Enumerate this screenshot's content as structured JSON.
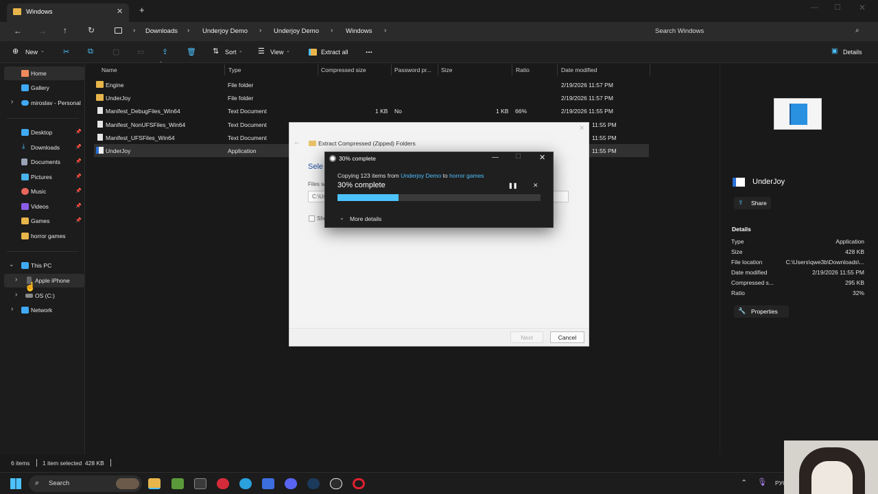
{
  "window": {
    "tab_title": "Windows",
    "new_tab_icon": "plus-icon",
    "controls": [
      "minimize-icon",
      "maximize-icon",
      "close-icon"
    ]
  },
  "address": {
    "crumbs": [
      "Downloads",
      "Underjoy Demo",
      "Underjoy Demo",
      "Windows"
    ],
    "search_placeholder": "Search Windows"
  },
  "toolbar": {
    "new_label": "New",
    "sort_label": "Sort",
    "view_label": "View",
    "extract_label": "Extract all",
    "more_label": "...",
    "details_label": "Details"
  },
  "sidebar": {
    "items": [
      {
        "label": "Home",
        "icon": "home-icon"
      },
      {
        "label": "Gallery",
        "icon": "gallery-icon"
      },
      {
        "label": "miroslav - Personal",
        "icon": "cloud-icon"
      },
      {
        "label": "Desktop",
        "icon": "desktop-icon"
      },
      {
        "label": "Downloads",
        "icon": "download-icon"
      },
      {
        "label": "Documents",
        "icon": "documents-icon"
      },
      {
        "label": "Pictures",
        "icon": "pictures-icon"
      },
      {
        "label": "Music",
        "icon": "music-icon"
      },
      {
        "label": "Videos",
        "icon": "videos-icon"
      },
      {
        "label": "Games",
        "icon": "folder-icon"
      },
      {
        "label": "horror games",
        "icon": "folder-icon"
      },
      {
        "label": "This PC",
        "icon": "pc-icon"
      },
      {
        "label": "Apple iPhone",
        "icon": "phone-icon"
      },
      {
        "label": "OS (C:)",
        "icon": "drive-icon"
      },
      {
        "label": "Network",
        "icon": "network-icon"
      }
    ]
  },
  "table": {
    "columns": [
      "Name",
      "Type",
      "Compressed size",
      "Password pr...",
      "Size",
      "Ratio",
      "Date modified"
    ],
    "rows": [
      {
        "name": "Engine",
        "type": "File folder",
        "compressed": "",
        "password": "",
        "size": "",
        "ratio": "",
        "date": "2/19/2026 11:57 PM",
        "icon": "folder-icon"
      },
      {
        "name": "UnderJoy",
        "type": "File folder",
        "compressed": "",
        "password": "",
        "size": "",
        "ratio": "",
        "date": "2/19/2026 11:57 PM",
        "icon": "folder-icon"
      },
      {
        "name": "Manifest_DebugFiles_Win64",
        "type": "Text Document",
        "compressed": "1 KB",
        "password": "No",
        "size": "1 KB",
        "ratio": "66%",
        "date": "2/19/2026 11:55 PM",
        "icon": "text-file-icon"
      },
      {
        "name": "Manifest_NonUFSFiles_Win64",
        "type": "Text Document",
        "compressed": "",
        "password": "",
        "size": "",
        "ratio": "",
        "date": "11:55 PM",
        "icon": "text-file-icon"
      },
      {
        "name": "Manifest_UFSFiles_Win64",
        "type": "Text Document",
        "compressed": "",
        "password": "",
        "size": "",
        "ratio": "",
        "date": "11:55 PM",
        "icon": "text-file-icon"
      },
      {
        "name": "UnderJoy",
        "type": "Application",
        "compressed": "",
        "password": "",
        "size": "",
        "ratio": "",
        "date": "11:55 PM",
        "icon": "app-icon"
      }
    ]
  },
  "extract_dialog": {
    "title": "Extract Compressed (Zipped) Folders",
    "heading_partial": "Sele",
    "files_partial": "Files w",
    "path_partial": "C:\\Us",
    "checkbox_partial": "Sho",
    "next_label": "Next",
    "cancel_label": "Cancel"
  },
  "progress": {
    "title": "30% complete",
    "copy_prefix": "Copying 123 items from ",
    "source": "Underjoy Demo",
    "to_word": " to ",
    "destination": "horror games",
    "percent_text": "30% complete",
    "fraction": 0.3,
    "more_details": "More details",
    "bar_color": "#4cc2ff"
  },
  "details_pane": {
    "file_name": "UnderJoy",
    "share_label": "Share",
    "section_title": "Details",
    "fields": [
      {
        "label": "Type",
        "value": "Application"
      },
      {
        "label": "Size",
        "value": "428 KB"
      },
      {
        "label": "File location",
        "value": "C:\\Users\\qwe3b\\Downloads\\..."
      },
      {
        "label": "Date modified",
        "value": "2/19/2026 11:55 PM"
      },
      {
        "label": "Compressed s...",
        "value": "295 KB"
      },
      {
        "label": "Ratio",
        "value": "32%"
      }
    ],
    "properties_label": "Properties"
  },
  "status": {
    "items_count": "6 items",
    "selection": "1 item selected  428 KB"
  },
  "taskbar": {
    "search_label": "Search",
    "tray_text": "РУС"
  },
  "colors": {
    "accent": "#4cc2ff",
    "folder": "#e8b54b",
    "link_blue": "#4cc2ff"
  }
}
